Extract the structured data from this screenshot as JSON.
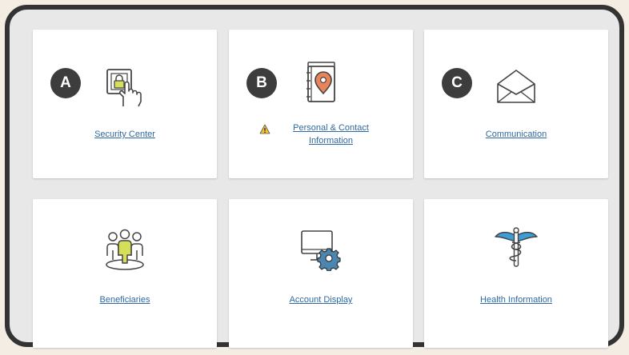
{
  "badges": {
    "a": "A",
    "b": "B",
    "c": "C"
  },
  "cards": [
    {
      "label": "Security Center",
      "icon": "lock-touch-icon"
    },
    {
      "label_line1": "Personal & Contact",
      "label_line2": "Information",
      "icon": "address-book-pin-icon",
      "has_warning": true
    },
    {
      "label": "Communication",
      "icon": "envelope-open-icon"
    },
    {
      "label": "Beneficiaries",
      "icon": "people-group-icon"
    },
    {
      "label": "Account Display",
      "icon": "monitor-gear-icon"
    },
    {
      "label": "Health Information",
      "icon": "caduceus-icon"
    }
  ],
  "colors": {
    "link": "#2e69a3",
    "badge": "#3d3d3d",
    "accent_orange": "#e8845a",
    "accent_yellow": "#d6df5a",
    "accent_blue": "#3d9ed6",
    "warning": "#f2c233"
  }
}
